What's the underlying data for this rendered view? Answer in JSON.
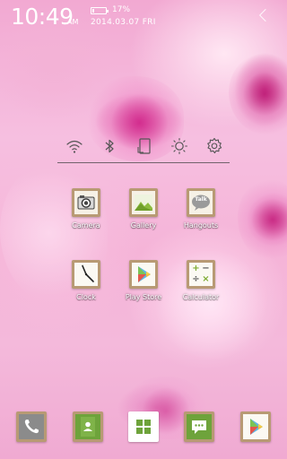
{
  "status_bar": {
    "time": "10:49",
    "ampm": "AM",
    "battery_percent": "17%",
    "battery_level": 0.17,
    "date": "2014.03.07  FRI"
  },
  "quick_toggles": [
    {
      "name": "wifi-icon"
    },
    {
      "name": "bluetooth-icon"
    },
    {
      "name": "rotation-icon"
    },
    {
      "name": "brightness-icon"
    },
    {
      "name": "settings-icon"
    }
  ],
  "apps": [
    {
      "label": "Camera",
      "icon": "camera-icon"
    },
    {
      "label": "Gallery",
      "icon": "gallery-icon"
    },
    {
      "label": "Hangouts",
      "icon": "hangouts-icon",
      "badge_text": "Talk"
    },
    {
      "label": "Clock",
      "icon": "clock-icon"
    },
    {
      "label": "Play Store",
      "icon": "play-store-icon"
    },
    {
      "label": "Calculator",
      "icon": "calculator-icon",
      "symbols": [
        "+",
        "−",
        "÷",
        "×"
      ]
    }
  ],
  "dock": [
    {
      "icon": "phone-icon"
    },
    {
      "icon": "contacts-icon"
    },
    {
      "icon": "app-drawer-icon"
    },
    {
      "icon": "messaging-icon"
    },
    {
      "icon": "play-store-icon"
    }
  ],
  "colors": {
    "frame": "#b89a74",
    "icon_bg": "#f6f1e6",
    "accent_green": "#8cbb3f"
  }
}
